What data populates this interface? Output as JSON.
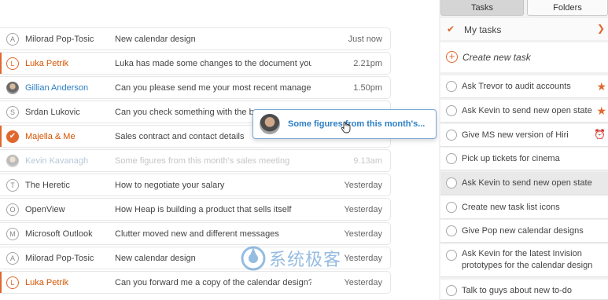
{
  "mails": [
    {
      "icon": "A",
      "icon_style": "gray",
      "sender": "Milorad Pop-Tosic",
      "sender_style": "normal",
      "subject": "New calendar design",
      "time": "Just now",
      "flag": false,
      "faded": false
    },
    {
      "icon": "L",
      "icon_style": "orange",
      "sender": "Luka Petrik",
      "sender_style": "orange",
      "subject": "Luka has made some changes to the document you ...",
      "time": "2.21pm",
      "flag": true,
      "faded": false
    },
    {
      "icon": "",
      "icon_style": "photo",
      "sender": "Gillian Anderson",
      "sender_style": "blue",
      "subject": "Can you please send me your most recent management...",
      "time": "1.50pm",
      "flag": false,
      "faded": false
    },
    {
      "icon": "S",
      "icon_style": "gray",
      "sender": "Srdan Lukovic",
      "sender_style": "normal",
      "subject": "Can you check something with the b",
      "time": "",
      "flag": false,
      "faded": false
    },
    {
      "icon": "✔",
      "icon_style": "filled",
      "sender": "Majella & Me",
      "sender_style": "orange",
      "subject": "Sales contract and contact details",
      "time": "",
      "flag": true,
      "faded": false
    },
    {
      "icon": "",
      "icon_style": "photo-faded",
      "sender": "Kevin Kavanagh",
      "sender_style": "faded",
      "subject": "Some figures from this month's sales meeting",
      "time": "9.13am",
      "flag": false,
      "faded": true
    },
    {
      "icon": "T",
      "icon_style": "gray",
      "sender": "The Heretic",
      "sender_style": "normal",
      "subject": "How to negotiate your salary",
      "time": "Yesterday",
      "flag": false,
      "faded": false
    },
    {
      "icon": "O",
      "icon_style": "gray",
      "sender": "OpenView",
      "sender_style": "normal",
      "subject": "How Heap is building a product that sells itself",
      "time": "Yesterday",
      "flag": false,
      "faded": false
    },
    {
      "icon": "M",
      "icon_style": "gray",
      "sender": "Microsoft Outlook",
      "sender_style": "normal",
      "subject": "Clutter moved new and different messages",
      "time": "Yesterday",
      "flag": false,
      "faded": false
    },
    {
      "icon": "A",
      "icon_style": "gray",
      "sender": "Milorad Pop-Tosic",
      "sender_style": "normal",
      "subject": "New calendar design",
      "time": "Yesterday",
      "flag": false,
      "faded": false
    },
    {
      "icon": "L",
      "icon_style": "orange",
      "sender": "Luka Petrik",
      "sender_style": "orange",
      "subject": "Can you forward me a copy of the calendar design?",
      "time": "Yesterday",
      "flag": true,
      "faded": false
    }
  ],
  "drag_card": {
    "text": "Some figures from this month's..."
  },
  "watermark": {
    "text": "系统极客"
  },
  "tabs": {
    "tasks": "Tasks",
    "folders": "Folders"
  },
  "list_header": {
    "label": "My tasks"
  },
  "create_task": {
    "label": "Create new task"
  },
  "tasks": [
    {
      "label": "Ask Trevor to audit accounts",
      "badge": "star",
      "selected": false
    },
    {
      "label": "Ask Kevin to send new open state",
      "badge": "star",
      "selected": false
    },
    {
      "label": "Give MS new version of Hiri",
      "badge": "alarm",
      "selected": false
    },
    {
      "label": "Pick up tickets for cinema",
      "badge": "",
      "selected": false
    },
    {
      "label": "Ask Kevin to send new open state",
      "badge": "",
      "selected": true
    },
    {
      "label": "Create new task list icons",
      "badge": "",
      "selected": false
    },
    {
      "label": "Give Pop new calendar designs",
      "badge": "",
      "selected": false
    },
    {
      "label": "Ask Kevin for the latest Invision prototypes for the calendar design",
      "badge": "",
      "selected": false
    },
    {
      "label": "Talk to guys about new to-do",
      "badge": "",
      "selected": false
    }
  ],
  "colors": {
    "accent": "#e0672d",
    "link": "#2b7ec4",
    "panel": "#f1f1f1"
  }
}
